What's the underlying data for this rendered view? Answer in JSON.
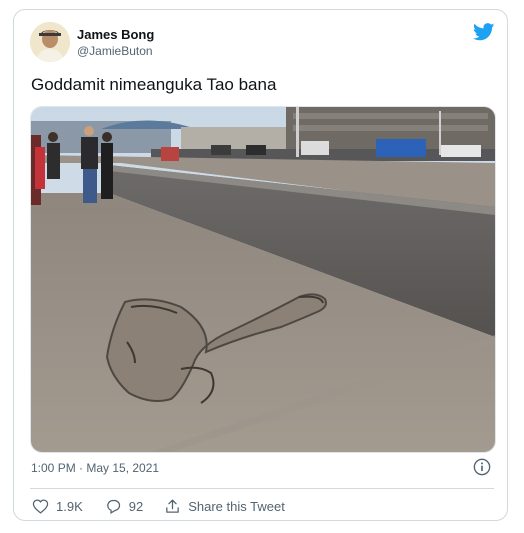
{
  "author": {
    "name": "James Bong",
    "handle": "@JamieButon"
  },
  "tweet": {
    "text": "Goddamit nimeanguka Tao bana",
    "timestamp": "1:00 PM · May 15, 2021"
  },
  "actions": {
    "likes": "1.9K",
    "replies": "92",
    "share_label": "Share this Tweet"
  },
  "icons": {
    "logo": "twitter-bird-icon",
    "info": "info-icon",
    "like": "heart-icon",
    "reply": "reply-bubble-icon",
    "share": "share-icon"
  },
  "colors": {
    "twitter_blue": "#1da1f2",
    "text_primary": "#0f1419",
    "text_secondary": "#536471",
    "border": "#cfd9de"
  }
}
